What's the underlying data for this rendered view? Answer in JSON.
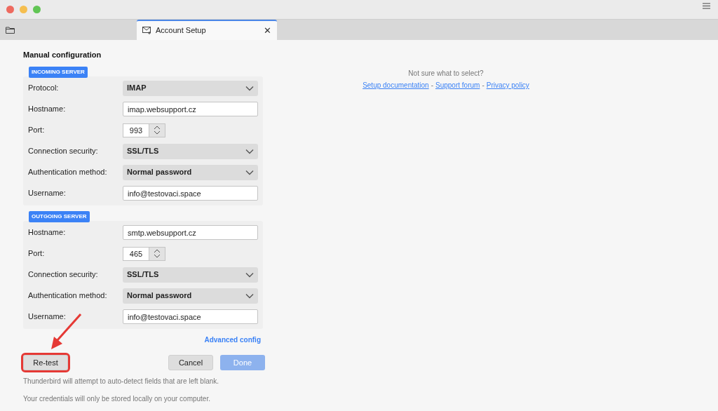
{
  "tabs": [
    {
      "kind": "folder",
      "selected": false
    },
    {
      "kind": "account",
      "label": "Account Setup",
      "close": "✕",
      "selected": true
    }
  ],
  "title": "Manual configuration",
  "sections": [
    {
      "label": "INCOMING SERVER",
      "fields": [
        {
          "kind": "select",
          "label": "Protocol:",
          "value": "IMAP"
        },
        {
          "kind": "text",
          "label": "Hostname:",
          "value": "imap.websupport.cz"
        },
        {
          "kind": "port",
          "label": "Port:",
          "value": "993"
        },
        {
          "kind": "select",
          "label": "Connection security:",
          "value": "SSL/TLS"
        },
        {
          "kind": "select",
          "label": "Authentication method:",
          "value": "Normal password"
        },
        {
          "kind": "text",
          "label": "Username:",
          "value": "info@testovaci.space"
        }
      ]
    },
    {
      "label": "OUTGOING SERVER",
      "fields": [
        {
          "kind": "text",
          "label": "Hostname:",
          "value": "smtp.websupport.cz"
        },
        {
          "kind": "port",
          "label": "Port:",
          "value": "465"
        },
        {
          "kind": "select",
          "label": "Connection security:",
          "value": "SSL/TLS"
        },
        {
          "kind": "select",
          "label": "Authentication method:",
          "value": "Normal password"
        },
        {
          "kind": "text",
          "label": "Username:",
          "value": "info@testovaci.space"
        }
      ]
    }
  ],
  "advanced_link": "Advanced config",
  "buttons": [
    {
      "label": "Re-test",
      "disabled": false,
      "highlighted": true
    },
    {
      "label": "Cancel",
      "disabled": false,
      "highlighted": false
    },
    {
      "label": "Done",
      "disabled": true,
      "highlighted": false
    }
  ],
  "notes": [
    "Thunderbird will attempt to auto-detect fields that are left blank.",
    "Your credentials will only be stored locally on your computer."
  ],
  "help": {
    "question": "Not sure what to select?",
    "separator": "-",
    "links": [
      "Setup documentation",
      "Support forum",
      "Privacy policy"
    ]
  }
}
